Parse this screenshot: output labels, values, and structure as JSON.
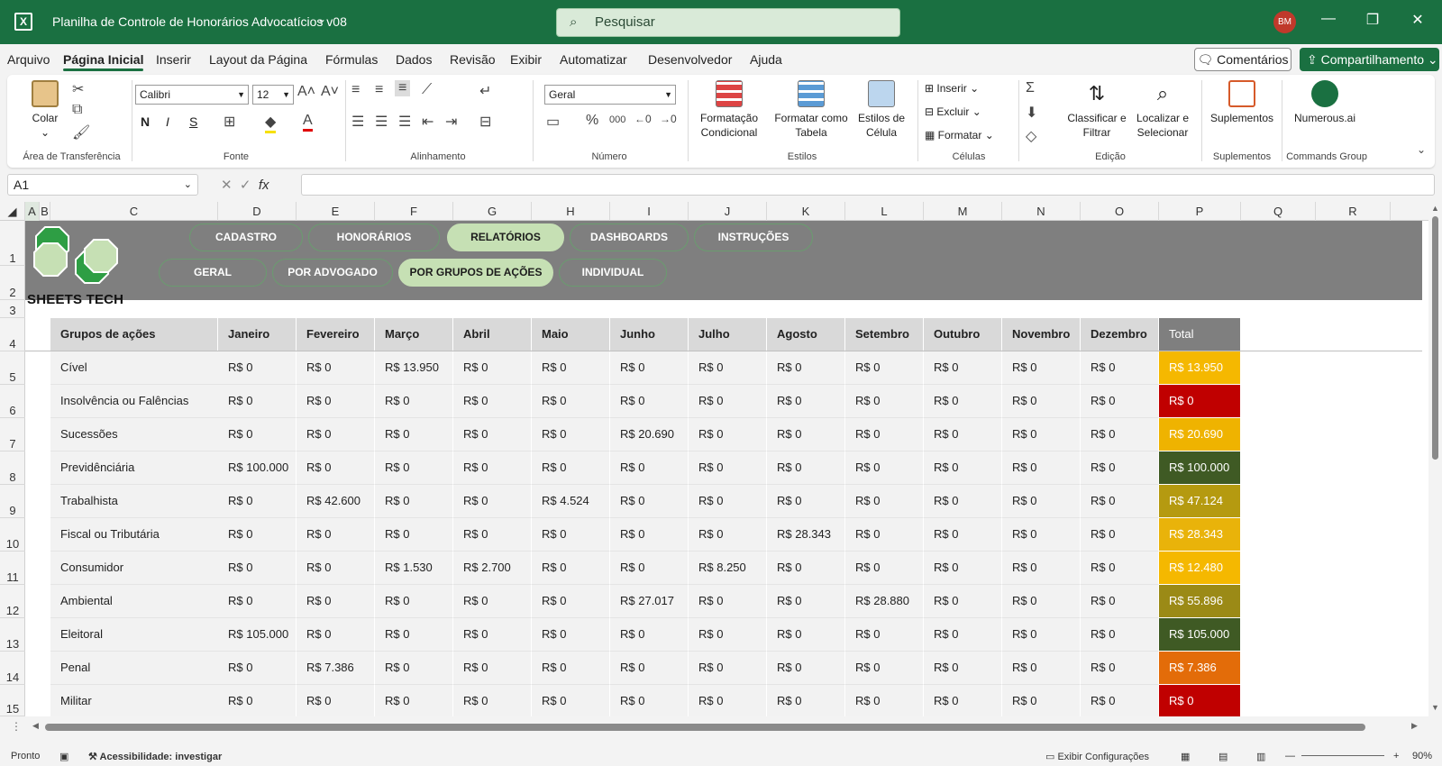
{
  "titlebar": {
    "title": "Planilha de Controle de Honorários Advocatícios v08",
    "search_placeholder": "Pesquisar",
    "avatar": "BM",
    "minimize": "—",
    "restore": "❐",
    "close": "✕"
  },
  "menu": {
    "items": [
      "Arquivo",
      "Página Inicial",
      "Inserir",
      "Layout da Página",
      "Fórmulas",
      "Dados",
      "Revisão",
      "Exibir",
      "Automatizar",
      "Desenvolvedor",
      "Ajuda"
    ],
    "active": "Página Inicial",
    "comments": "Comentários",
    "share": "Compartilhamento"
  },
  "ribbon": {
    "clipboard": {
      "paste": "Colar",
      "label": "Área de Transferência"
    },
    "font": {
      "name": "Calibri",
      "size": "12",
      "bold": "N",
      "italic": "I",
      "underline": "S",
      "label": "Fonte"
    },
    "alignment": {
      "label": "Alinhamento"
    },
    "number": {
      "format": "Geral",
      "label": "Número"
    },
    "styles": {
      "conditional": "Formatação Condicional",
      "table": "Formatar como Tabela",
      "cell_styles": "Estilos de Célula",
      "label": "Estilos"
    },
    "cells": {
      "insert": "Inserir",
      "delete": "Excluir",
      "format": "Formatar",
      "label": "Células"
    },
    "editing": {
      "sort": "Classificar e Filtrar",
      "find": "Localizar e Selecionar",
      "label": "Edição"
    },
    "addins": {
      "button": "Suplementos",
      "label": "Suplementos"
    },
    "commands": {
      "button": "Numerous.ai",
      "label": "Commands Group"
    }
  },
  "formula_bar": {
    "name_box": "A1",
    "formula": ""
  },
  "columns": [
    "A",
    "B",
    "C",
    "D",
    "E",
    "F",
    "G",
    "H",
    "I",
    "J",
    "K",
    "L",
    "M",
    "N",
    "O",
    "P",
    "Q",
    "R"
  ],
  "rows": [
    "1",
    "2",
    "3",
    "4",
    "5",
    "6",
    "7",
    "8",
    "9",
    "10",
    "11",
    "12",
    "13",
    "14",
    "15"
  ],
  "nav": {
    "main": [
      "CADASTRO",
      "HONORÁRIOS",
      "RELATÓRIOS",
      "DASHBOARDS",
      "INSTRUÇÕES"
    ],
    "main_active": "RELATÓRIOS",
    "sub": [
      "GERAL",
      "POR ADVOGADO",
      "POR GRUPOS DE AÇÕES",
      "INDIVIDUAL"
    ],
    "sub_active": "POR GRUPOS DE AÇÕES"
  },
  "brand": "SHEETS TECH",
  "table": {
    "headers": [
      "Grupos de ações",
      "Janeiro",
      "Fevereiro",
      "Março",
      "Abril",
      "Maio",
      "Junho",
      "Julho",
      "Agosto",
      "Setembro",
      "Outubro",
      "Novembro",
      "Dezembro",
      "Total"
    ],
    "rows": [
      {
        "group": "Cível",
        "values": [
          "R$ 0",
          "R$ 0",
          "R$ 13.950",
          "R$ 0",
          "R$ 0",
          "R$ 0",
          "R$ 0",
          "R$ 0",
          "R$ 0",
          "R$ 0",
          "R$ 0",
          "R$ 0"
        ],
        "total": "R$ 13.950",
        "color": "#f5b800"
      },
      {
        "group": "Insolvência ou Falências",
        "values": [
          "R$ 0",
          "R$ 0",
          "R$ 0",
          "R$ 0",
          "R$ 0",
          "R$ 0",
          "R$ 0",
          "R$ 0",
          "R$ 0",
          "R$ 0",
          "R$ 0",
          "R$ 0"
        ],
        "total": "R$ 0",
        "color": "#c00000"
      },
      {
        "group": "Sucessões",
        "values": [
          "R$ 0",
          "R$ 0",
          "R$ 0",
          "R$ 0",
          "R$ 0",
          "R$ 20.690",
          "R$ 0",
          "R$ 0",
          "R$ 0",
          "R$ 0",
          "R$ 0",
          "R$ 0"
        ],
        "total": "R$ 20.690",
        "color": "#efb300"
      },
      {
        "group": "Previdênciária",
        "values": [
          "R$ 100.000",
          "R$ 0",
          "R$ 0",
          "R$ 0",
          "R$ 0",
          "R$ 0",
          "R$ 0",
          "R$ 0",
          "R$ 0",
          "R$ 0",
          "R$ 0",
          "R$ 0"
        ],
        "total": "R$ 100.000",
        "color": "#3f5a24"
      },
      {
        "group": "Trabalhista",
        "values": [
          "R$ 0",
          "R$ 42.600",
          "R$ 0",
          "R$ 0",
          "R$ 4.524",
          "R$ 0",
          "R$ 0",
          "R$ 0",
          "R$ 0",
          "R$ 0",
          "R$ 0",
          "R$ 0"
        ],
        "total": "R$ 47.124",
        "color": "#b59a10"
      },
      {
        "group": "Fiscal ou Tributária",
        "values": [
          "R$ 0",
          "R$ 0",
          "R$ 0",
          "R$ 0",
          "R$ 0",
          "R$ 0",
          "R$ 0",
          "R$ 28.343",
          "R$ 0",
          "R$ 0",
          "R$ 0",
          "R$ 0"
        ],
        "total": "R$ 28.343",
        "color": "#e9b30a"
      },
      {
        "group": "Consumidor",
        "values": [
          "R$ 0",
          "R$ 0",
          "R$ 1.530",
          "R$ 2.700",
          "R$ 0",
          "R$ 0",
          "R$ 8.250",
          "R$ 0",
          "R$ 0",
          "R$ 0",
          "R$ 0",
          "R$ 0"
        ],
        "total": "R$ 12.480",
        "color": "#f5b800"
      },
      {
        "group": "Ambiental",
        "values": [
          "R$ 0",
          "R$ 0",
          "R$ 0",
          "R$ 0",
          "R$ 0",
          "R$ 27.017",
          "R$ 0",
          "R$ 0",
          "R$ 28.880",
          "R$ 0",
          "R$ 0",
          "R$ 0"
        ],
        "total": "R$ 55.896",
        "color": "#9b8a16"
      },
      {
        "group": "Eleitoral",
        "values": [
          "R$ 105.000",
          "R$ 0",
          "R$ 0",
          "R$ 0",
          "R$ 0",
          "R$ 0",
          "R$ 0",
          "R$ 0",
          "R$ 0",
          "R$ 0",
          "R$ 0",
          "R$ 0"
        ],
        "total": "R$ 105.000",
        "color": "#3f5a24"
      },
      {
        "group": "Penal",
        "values": [
          "R$ 0",
          "R$ 7.386",
          "R$ 0",
          "R$ 0",
          "R$ 0",
          "R$ 0",
          "R$ 0",
          "R$ 0",
          "R$ 0",
          "R$ 0",
          "R$ 0",
          "R$ 0"
        ],
        "total": "R$ 7.386",
        "color": "#e36c09"
      },
      {
        "group": "Militar",
        "values": [
          "R$ 0",
          "R$ 0",
          "R$ 0",
          "R$ 0",
          "R$ 0",
          "R$ 0",
          "R$ 0",
          "R$ 0",
          "R$ 0",
          "R$ 0",
          "R$ 0",
          "R$ 0"
        ],
        "total": "R$ 0",
        "color": "#c00000"
      }
    ]
  },
  "status": {
    "ready": "Pronto",
    "accessibility": "Acessibilidade: investigar",
    "display_settings": "Exibir Configurações",
    "zoom": "90%"
  },
  "colors": {
    "excel_green": "#1a7041",
    "banner_gray": "#7f7f7f",
    "pill_active": "#c6e0b4"
  }
}
